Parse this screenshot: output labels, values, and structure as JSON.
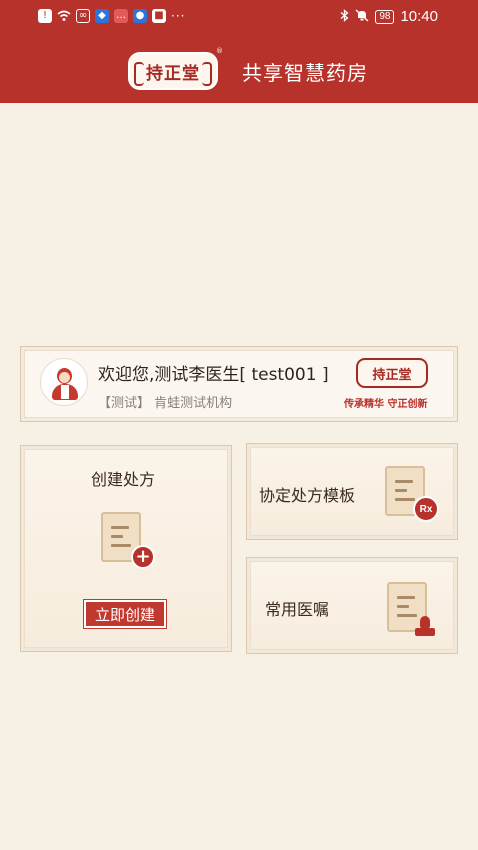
{
  "status_bar": {
    "time": "10:40",
    "battery": "98",
    "overflow": "···"
  },
  "header": {
    "logo_text": "持正堂",
    "registered_mark": "®",
    "title": "共享智慧药房",
    "background_color": "#b8322c"
  },
  "welcome": {
    "greeting": "欢迎您,测试李医生[ test001 ]",
    "organization": "【测试】 肯蛙测试机构",
    "brand_logo": "持正堂",
    "slogan": "传承精华 守正创新"
  },
  "cards": {
    "create_prescription": {
      "title": "创建处方",
      "button_label": "立即创建",
      "icon": "document-plus-icon"
    },
    "agreement_template": {
      "title": "协定处方模板",
      "icon": "document-rx-icon",
      "badge": "Rx"
    },
    "common_advice": {
      "title": "常用医嘱",
      "icon": "document-stamp-icon"
    }
  },
  "colors": {
    "accent": "#b8322c",
    "page_background": "#f7f0e5"
  }
}
